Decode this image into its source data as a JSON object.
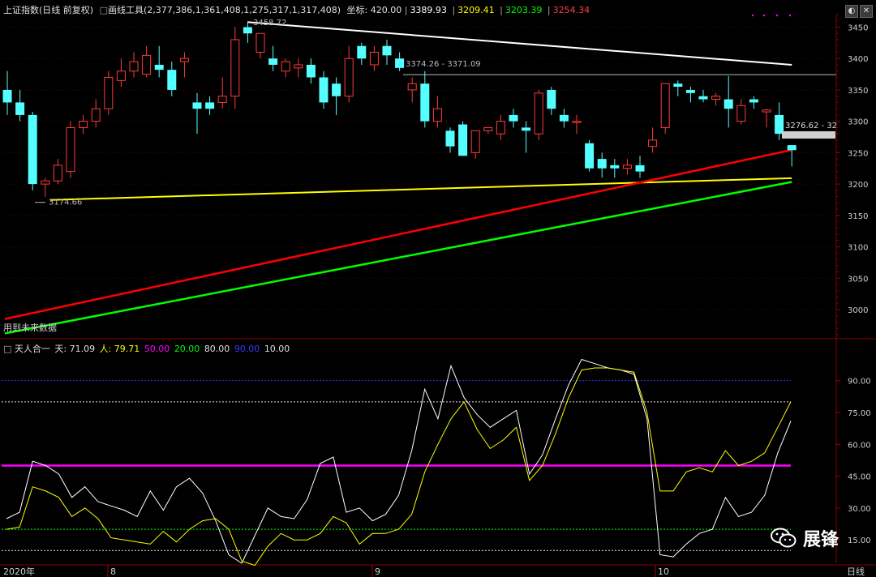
{
  "header": {
    "title": "上证指数(日线 前复权)",
    "tool_label": "画线工具",
    "tool_values": "(2,377,386,1,361,408,1,275,317,1,317,408)",
    "coord_label": "坐标: 420.00",
    "val1": "3389.93",
    "val2": "3209.41",
    "val3": "3203.39",
    "val4": "3254.34"
  },
  "indicator_header": {
    "name": "天人合一",
    "tian": "天: 71.09",
    "ren": "人: 79.71",
    "l50": "50.00",
    "l20": "20.00",
    "l80": "80.00",
    "l90": "90.00",
    "l10": "10.00"
  },
  "annotations": {
    "high_label": "3458.72",
    "low_label": "3174.66",
    "range_label": "3374.26 - 3371.09",
    "price_tag": "3276.62 - 32",
    "future_label": "用到未来数据"
  },
  "bottom_axis": {
    "year": "2020年",
    "m8": "8",
    "m9": "9",
    "m10": "10",
    "period": "日线"
  },
  "watermark": "展锋",
  "colors": {
    "bg": "#000000",
    "up": "#ff3b3b",
    "down": "#54ffff",
    "white_line": "#ffffff",
    "yellow": "#ffff00",
    "red": "#ff0000",
    "green": "#00ff00",
    "magenta": "#ff00ff",
    "navy": "#3030ff",
    "grid": "#7a0000"
  },
  "chart_data": [
    {
      "type": "candlestick",
      "title": "上证指数(日线 前复权)",
      "ylim": [
        2960,
        3470
      ],
      "yticks": [
        3000,
        3050,
        3100,
        3150,
        3200,
        3250,
        3300,
        3350,
        3400,
        3450
      ],
      "candles": [
        [
          3350,
          3380,
          3310,
          3330
        ],
        [
          3330,
          3350,
          3300,
          3310
        ],
        [
          3310,
          3315,
          3190,
          3200
        ],
        [
          3200,
          3210,
          3180,
          3205
        ],
        [
          3205,
          3240,
          3200,
          3230
        ],
        [
          3220,
          3300,
          3210,
          3290
        ],
        [
          3290,
          3310,
          3280,
          3300
        ],
        [
          3300,
          3335,
          3290,
          3320
        ],
        [
          3320,
          3380,
          3310,
          3370
        ],
        [
          3365,
          3400,
          3355,
          3380
        ],
        [
          3380,
          3410,
          3370,
          3395
        ],
        [
          3375,
          3420,
          3370,
          3405
        ],
        [
          3390,
          3420,
          3370,
          3382
        ],
        [
          3382,
          3395,
          3340,
          3350
        ],
        [
          3395,
          3410,
          3370,
          3400
        ],
        [
          3330,
          3345,
          3280,
          3320
        ],
        [
          3330,
          3340,
          3310,
          3320
        ],
        [
          3330,
          3370,
          3320,
          3340
        ],
        [
          3340,
          3450,
          3320,
          3430
        ],
        [
          3450,
          3458,
          3425,
          3440
        ],
        [
          3410,
          3440,
          3400,
          3440
        ],
        [
          3400,
          3420,
          3380,
          3390
        ],
        [
          3380,
          3400,
          3370,
          3395
        ],
        [
          3385,
          3400,
          3370,
          3390
        ],
        [
          3390,
          3400,
          3360,
          3370
        ],
        [
          3370,
          3380,
          3320,
          3330
        ],
        [
          3360,
          3370,
          3310,
          3340
        ],
        [
          3340,
          3420,
          3330,
          3400
        ],
        [
          3420,
          3425,
          3390,
          3400
        ],
        [
          3390,
          3420,
          3380,
          3410
        ],
        [
          3420,
          3430,
          3390,
          3405
        ],
        [
          3400,
          3410,
          3380,
          3385
        ],
        [
          3350,
          3370,
          3330,
          3360
        ],
        [
          3360,
          3380,
          3290,
          3300
        ],
        [
          3300,
          3340,
          3290,
          3320
        ],
        [
          3285,
          3290,
          3250,
          3260
        ],
        [
          3295,
          3300,
          3245,
          3245
        ],
        [
          3250,
          3280,
          3240,
          3285
        ],
        [
          3285,
          3290,
          3280,
          3290
        ],
        [
          3280,
          3310,
          3270,
          3300
        ],
        [
          3310,
          3320,
          3290,
          3300
        ],
        [
          3290,
          3300,
          3250,
          3285
        ],
        [
          3280,
          3350,
          3270,
          3345
        ],
        [
          3350,
          3355,
          3310,
          3320
        ],
        [
          3310,
          3320,
          3290,
          3300
        ],
        [
          3300,
          3310,
          3280,
          3300
        ],
        [
          3265,
          3270,
          3220,
          3225
        ],
        [
          3240,
          3250,
          3210,
          3225
        ],
        [
          3230,
          3240,
          3210,
          3225
        ],
        [
          3225,
          3240,
          3215,
          3230
        ],
        [
          3230,
          3245,
          3210,
          3220
        ],
        [
          3260,
          3290,
          3250,
          3270
        ],
        [
          3290,
          3360,
          3280,
          3360
        ],
        [
          3360,
          3365,
          3340,
          3355
        ],
        [
          3350,
          3355,
          3330,
          3345
        ],
        [
          3340,
          3350,
          3330,
          3335
        ],
        [
          3335,
          3345,
          3325,
          3340
        ],
        [
          3335,
          3372,
          3290,
          3320
        ],
        [
          3300,
          3335,
          3295,
          3325
        ],
        [
          3335,
          3340,
          3320,
          3330
        ],
        [
          3315,
          3320,
          3290,
          3318
        ],
        [
          3310,
          3330,
          3270,
          3280
        ],
        [
          3262,
          3262,
          3228,
          3254
        ]
      ],
      "lines": [
        {
          "name": "white",
          "values": [
            3458,
            3390
          ]
        },
        {
          "name": "yellow",
          "values": [
            3174.66,
            3209.41
          ]
        },
        {
          "name": "red",
          "values": [
            2985,
            3254.34
          ]
        },
        {
          "name": "green",
          "values": [
            2962,
            3203.39
          ]
        },
        {
          "name": "hline",
          "values": [
            3374.26,
            3374.26
          ]
        }
      ]
    },
    {
      "type": "line",
      "title": "天人合一",
      "ylim": [
        4,
        104
      ],
      "yticks": [
        15,
        30,
        45,
        60,
        75,
        90
      ],
      "levels": [
        10,
        20,
        50,
        80,
        90
      ],
      "series": [
        {
          "name": "天",
          "values": [
            25,
            28,
            52,
            50,
            46,
            35,
            40,
            33,
            31,
            29,
            26,
            38,
            29,
            40,
            44,
            37,
            24,
            8,
            4,
            17,
            30,
            26,
            25,
            34,
            51,
            54,
            28,
            30,
            24,
            27,
            36,
            57,
            86,
            72,
            97,
            82,
            74,
            68,
            72,
            76,
            46,
            55,
            72,
            88,
            100,
            98,
            96,
            95,
            93,
            72,
            8,
            7,
            13,
            18,
            20,
            35,
            26,
            28,
            36,
            56,
            71
          ]
        },
        {
          "name": "人",
          "values": [
            20,
            21,
            40,
            38,
            35,
            26,
            30,
            25,
            16,
            15,
            14,
            13,
            19,
            14,
            20,
            24,
            25,
            20,
            5,
            3,
            12,
            18,
            15,
            15,
            18,
            26,
            23,
            13,
            18,
            18,
            20,
            27,
            47,
            60,
            72,
            80,
            67,
            58,
            62,
            68,
            43,
            50,
            65,
            82,
            95,
            96,
            96,
            95,
            94,
            75,
            38,
            38,
            47,
            49,
            47,
            57,
            50,
            52,
            56,
            68,
            80
          ]
        }
      ]
    }
  ]
}
